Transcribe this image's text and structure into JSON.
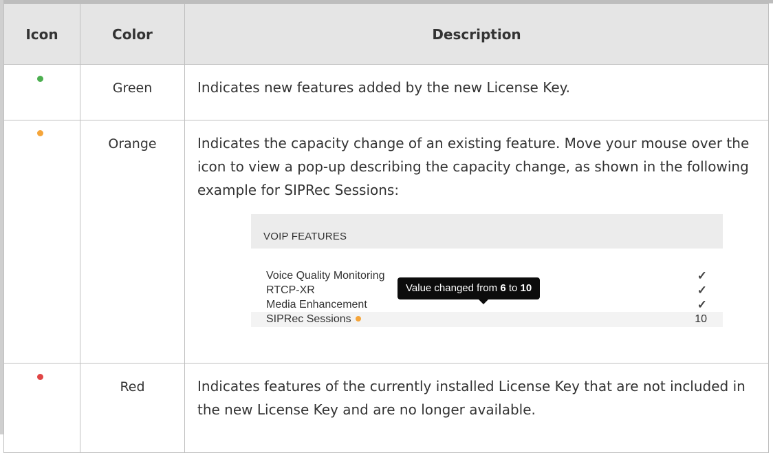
{
  "table": {
    "headers": {
      "icon": "Icon",
      "color": "Color",
      "description": "Description"
    },
    "rows": [
      {
        "icon": "green-dot-icon",
        "dot_color": "#4caf50",
        "color": "Green",
        "description": "Indicates new features added by the new License Key."
      },
      {
        "icon": "orange-dot-icon",
        "dot_color": "#f5a53a",
        "color": "Orange",
        "description": "Indicates the capacity change of an existing feature. Move your mouse over the icon to view a pop-up describing the capacity change, as shown in the following example for SIPRec Sessions:"
      },
      {
        "icon": "red-dot-icon",
        "dot_color": "#e04545",
        "color": "Red",
        "description": "Indicates features of the currently installed License Key that are not included in the new License Key and are no longer available."
      }
    ]
  },
  "example": {
    "header": "VOIP FEATURES",
    "features": [
      {
        "name": "Voice Quality Monitoring",
        "value": "✓",
        "icon": "checkbox-checked-icon"
      },
      {
        "name": "RTCP-XR",
        "value": "✓",
        "icon": "checkbox-checked-icon"
      },
      {
        "name": "Media Enhancement",
        "value": "✓",
        "icon": "checkbox-checked-icon"
      },
      {
        "name": "SIPRec Sessions",
        "value": "10",
        "icon": "orange-dot-icon"
      }
    ],
    "tooltip": {
      "prefix": "Value changed from",
      "from": "6",
      "middle": "to",
      "to": "10"
    }
  }
}
